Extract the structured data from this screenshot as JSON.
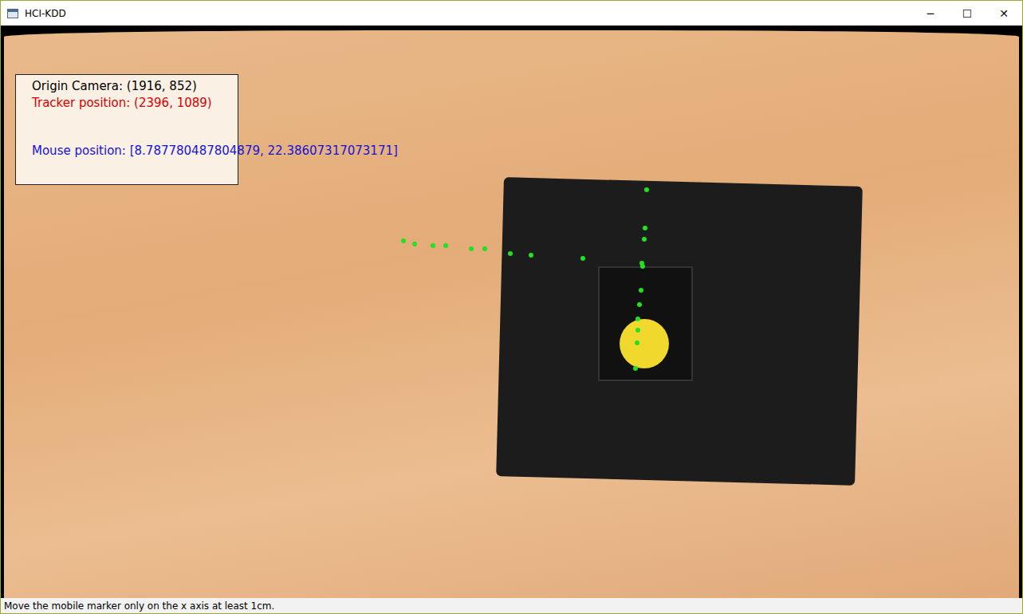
{
  "window": {
    "title": "HCI-KDD",
    "controls": [
      "─",
      "☐",
      "✕"
    ]
  },
  "overlay": {
    "lines": [
      {
        "text": "Origin Camera: (1916, 852)",
        "color": "#000000"
      },
      {
        "text": "Tracker position: (2396, 1089)",
        "color": "#d40000"
      },
      {
        "text": "Mouse position: [8.787780487804879, 22.38607317073171]",
        "color": "#1414d8"
      }
    ]
  },
  "status_bar": "Move the mobile marker only on the x axis at least 1cm."
}
